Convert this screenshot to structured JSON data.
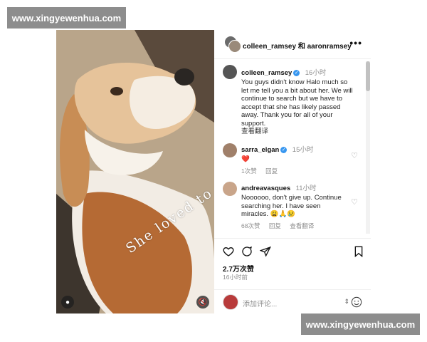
{
  "watermarks": {
    "top": "www.xingyewenhua.com",
    "bottom": "www.xingyewenhua.com"
  },
  "photo": {
    "caption": "She loved to sleep!"
  },
  "post": {
    "header_title": "colleen_ramsey 和 aaronramsey",
    "more": "•••",
    "comments": [
      {
        "user": "colleen_ramsey",
        "time": "16小时",
        "text": "You guys didn't know Halo much so let me tell you a bit about her. We will continue to search but we have to accept that she has likely passed away. Thank you for all of your support.",
        "translate": "查看翻译"
      },
      {
        "user": "sarra_elgan",
        "time": "15小时",
        "text": "❤️",
        "likes": "1次赞",
        "reply": "回复"
      },
      {
        "user": "andreavasques",
        "time": "11小时",
        "text": "Noooooo, don't give up. Continue searching her. I have seen miracles. 😩🙏😢",
        "likes": "68次赞",
        "reply": "回复",
        "translate": "查看翻译"
      }
    ],
    "likes": "2.7万次赞",
    "time_ago": "16小时前",
    "comment_placeholder": "添加评论..."
  },
  "colors": {
    "verified": "#3897f0",
    "heart_red": "#ed4956"
  },
  "icons": [
    "heart-icon",
    "comment-icon",
    "share-icon",
    "bookmark-icon",
    "more-icon",
    "emoji-icon",
    "mute-icon",
    "user-tag-icon",
    "verified-icon"
  ]
}
